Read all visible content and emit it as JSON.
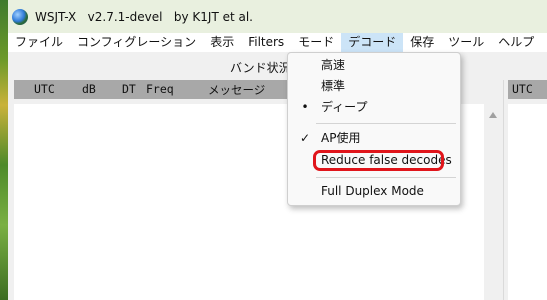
{
  "window": {
    "title": "WSJT-X   v2.7.1-devel   by K1JT et al."
  },
  "menubar": {
    "items": [
      {
        "label": "ファイル"
      },
      {
        "label": "コンフィグレーション"
      },
      {
        "label": "表示"
      },
      {
        "label": "Filters"
      },
      {
        "label": "モード"
      },
      {
        "label": "デコード"
      },
      {
        "label": "保存"
      },
      {
        "label": "ツール"
      },
      {
        "label": "ヘルプ"
      }
    ],
    "active": "デコード"
  },
  "band_activity": {
    "label": "バンド状況"
  },
  "table_header": {
    "utc": "UTC",
    "db": "dB",
    "dt": "DT",
    "freq": "Freq",
    "message": "メッセージ"
  },
  "right_panel_header": {
    "utc": "UTC"
  },
  "decode_menu": {
    "items": [
      {
        "label": "高速",
        "mark": ""
      },
      {
        "label": "標準",
        "mark": ""
      },
      {
        "label": "ディープ",
        "mark": "•"
      },
      {
        "label": "AP使用",
        "mark": "✓"
      },
      {
        "label": "Reduce false decodes",
        "mark": "",
        "highlighted": true
      },
      {
        "label": "Full Duplex Mode",
        "mark": ""
      }
    ]
  },
  "colors": {
    "highlight_ring": "#e0151b",
    "menu_active": "#cce4f7",
    "header_bg": "#a8a8a8"
  },
  "icons": {
    "app": "wsjtx-globe-icon",
    "scroll_up": "scroll-up-arrow-icon"
  }
}
